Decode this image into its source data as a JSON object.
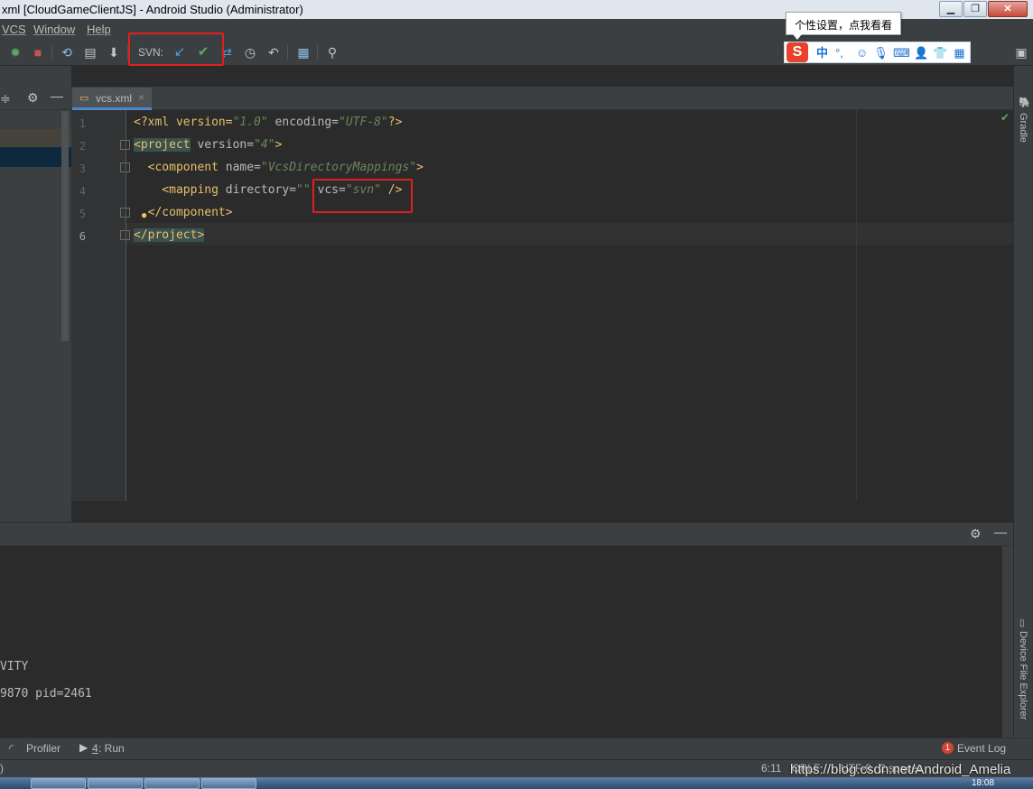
{
  "window": {
    "title": "xml [CloudGameClientJS] - Android Studio (Administrator)",
    "controls": {
      "minimize": "▁",
      "restore": "❐",
      "close": "✕"
    }
  },
  "menu": {
    "items": [
      "VCS",
      "Window",
      "Help"
    ]
  },
  "toolbar": {
    "svn_label": "SVN:",
    "icons": [
      "debug-icon",
      "stop-icon",
      "attach-icon",
      "apk-icon",
      "sdk-icon",
      "svn-update-icon",
      "svn-commit-icon",
      "svn-compare-icon",
      "history-icon",
      "revert-icon",
      "project-structure-icon",
      "search-icon"
    ]
  },
  "ime": {
    "tooltip": "个性设置，点我看看",
    "mode": "中",
    "punct": "°,"
  },
  "editor": {
    "tab_label": "vcs.xml",
    "tab_close": "×",
    "lines": [
      {
        "n": "1",
        "a": "<?xml version=",
        "b": "\"1.0\"",
        "c": " encoding=",
        "d": "\"UTF-8\"",
        "e": "?>"
      },
      {
        "n": "2",
        "a": "<project",
        "b": " version=",
        "c": "\"4\"",
        "d": ">",
        "e": ""
      },
      {
        "n": "3",
        "a": "  <component",
        "b": " name=",
        "c": "\"VcsDirectoryMappings\"",
        "d": ">",
        "e": ""
      },
      {
        "n": "4",
        "a": "    <mapping",
        "b": " directory=",
        "c": "\"\"",
        "d": " vcs=",
        "e": "\"svn\"",
        "f": " />"
      },
      {
        "n": "5",
        "a": "  </component>"
      },
      {
        "n": "6",
        "a": "</project>"
      }
    ]
  },
  "right_stripe": {
    "gradle": "Gradle",
    "device_explorer": "Device File Explorer"
  },
  "bottom_panel": {
    "log_lines": [
      "VITY",
      "9870 pid=2461"
    ]
  },
  "tool_buttons": {
    "profiler": "Profiler",
    "run_prefix": "4",
    "run_label": ": Run",
    "event_badge": "1",
    "event_log": "Event Log"
  },
  "status_bar": {
    "left": ")",
    "position": "6:11",
    "line_sep": "CRLF",
    "encoding": "UTF-8",
    "indent": "2 spaces",
    "watermark": "https://blog.csdn.net/Android_Amelia"
  },
  "taskbar": {
    "time": "18:08"
  }
}
